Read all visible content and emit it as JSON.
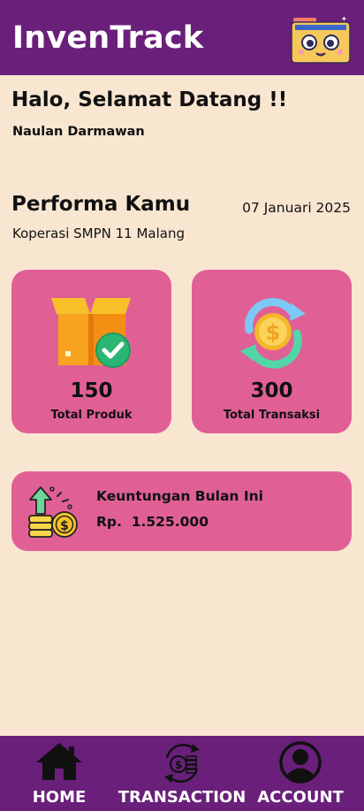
{
  "header": {
    "title": "InvenTrack",
    "logo_icon": "folder-with-face-icon"
  },
  "greeting": {
    "title": "Halo, Selamat Datang !!",
    "user_name": "Naulan Darmawan"
  },
  "performance": {
    "title": "Performa Kamu",
    "date": "07 Januari 2025",
    "store": "Koperasi SMPN 11 Malang"
  },
  "stats": [
    {
      "value": "150",
      "label": "Total Produk",
      "icon": "box-check-icon"
    },
    {
      "value": "300",
      "label": "Total Transaksi",
      "icon": "coin-exchange-icon"
    }
  ],
  "profit": {
    "label": "Keuntungan Bulan Ini",
    "value": "Rp.  1.525.000",
    "icon": "coins-growth-icon"
  },
  "nav": [
    {
      "label": "HOME",
      "icon": "home-icon"
    },
    {
      "label": "TRANSACTION",
      "icon": "transaction-icon"
    },
    {
      "label": "ACCOUNT",
      "icon": "account-icon"
    }
  ],
  "colors": {
    "primary": "#6a1f7b",
    "background": "#f9e6d1",
    "card": "#e06096"
  }
}
